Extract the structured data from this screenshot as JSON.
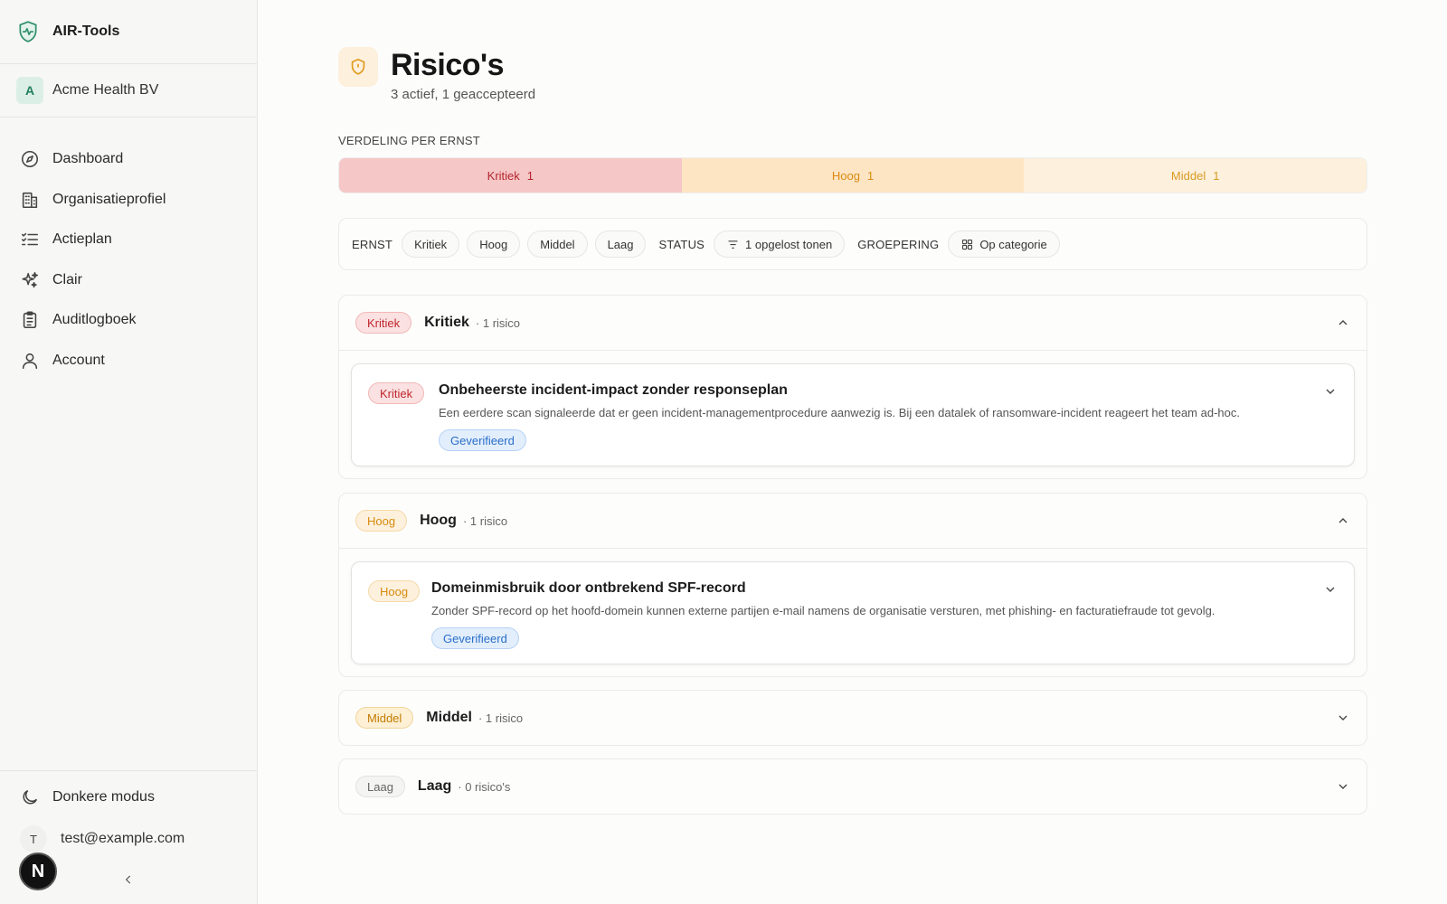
{
  "app": {
    "name": "AIR-Tools"
  },
  "org": {
    "initial": "A",
    "name": "Acme Health BV"
  },
  "nav": [
    {
      "label": "Dashboard",
      "icon": "compass-icon"
    },
    {
      "label": "Organisatieprofiel",
      "icon": "building-icon"
    },
    {
      "label": "Actieplan",
      "icon": "list-check-icon"
    },
    {
      "label": "Clair",
      "icon": "sparkles-icon"
    },
    {
      "label": "Auditlogboek",
      "icon": "clipboard-icon"
    },
    {
      "label": "Account",
      "icon": "user-icon"
    }
  ],
  "footer": {
    "dark_mode": "Donkere modus",
    "user_initial": "T",
    "user_email": "test@example.com",
    "next_badge": "N"
  },
  "page": {
    "title": "Risico's",
    "subtitle": "3 actief, 1 geaccepteerd"
  },
  "distribution": {
    "label": "VERDELING PER ERNST",
    "segments": [
      {
        "label": "Kritiek",
        "count": "1",
        "color": "#f6c7c7"
      },
      {
        "label": "Hoog",
        "count": "1",
        "color": "#fde5c4"
      },
      {
        "label": "Middel",
        "count": "1",
        "color": "#fdf0dc"
      }
    ]
  },
  "filters": {
    "severity_label": "ERNST",
    "severity_options": [
      "Kritiek",
      "Hoog",
      "Middel",
      "Laag"
    ],
    "status_label": "STATUS",
    "status_value": "1 opgelost tonen",
    "grouping_label": "GROEPERING",
    "grouping_value": "Op categorie"
  },
  "groups": [
    {
      "badge": "Kritiek",
      "title": "Kritiek",
      "count": "· 1 risico",
      "expanded": true,
      "items": [
        {
          "badge": "Kritiek",
          "title": "Onbeheerste incident-impact zonder responseplan",
          "description": "Een eerdere scan signaleerde dat er geen incident-managementprocedure aanwezig is. Bij een datalek of ransomware-incident reageert het team ad-hoc.",
          "status": "Geverifieerd"
        }
      ]
    },
    {
      "badge": "Hoog",
      "title": "Hoog",
      "count": "· 1 risico",
      "expanded": true,
      "items": [
        {
          "badge": "Hoog",
          "title": "Domeinmisbruik door ontbrekend SPF-record",
          "description": "Zonder SPF-record op het hoofd-domein kunnen externe partijen e-mail namens de organisatie versturen, met phishing- en facturatiefraude tot gevolg.",
          "status": "Geverifieerd"
        }
      ]
    },
    {
      "badge": "Middel",
      "title": "Middel",
      "count": "· 1 risico",
      "expanded": false
    },
    {
      "badge": "Laag",
      "title": "Laag",
      "count": "· 0 risico's",
      "expanded": false
    }
  ]
}
